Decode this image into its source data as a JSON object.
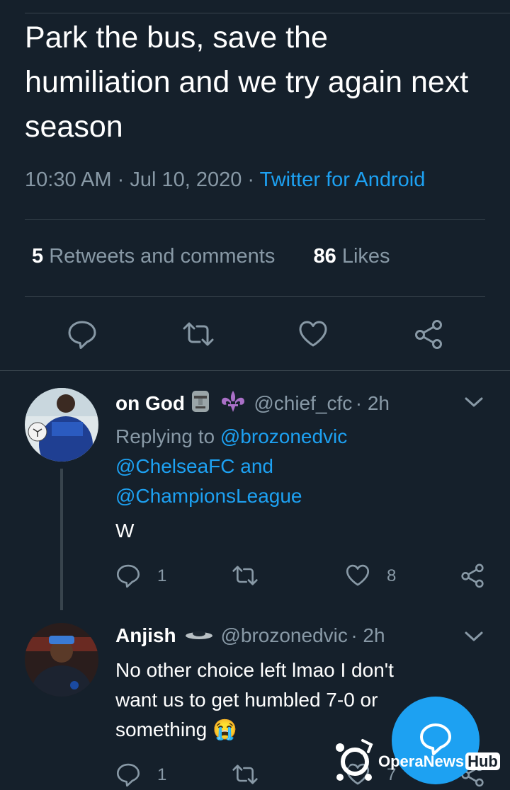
{
  "tweet": {
    "text": "Park the bus, save the humiliation and we try again next season",
    "time": "10:30 AM",
    "date": "Jul 10, 2020",
    "source": "Twitter for Android",
    "sep": "·",
    "retweets_count": "5",
    "retweets_label": "Retweets and comments",
    "likes_count": "86",
    "likes_label": "Likes"
  },
  "actions": {
    "icons": [
      "reply-icon",
      "retweet-icon",
      "like-icon",
      "share-icon"
    ]
  },
  "replies": [
    {
      "name": "on God",
      "handle": "@chief_cfc",
      "time": "· 2h",
      "replying_prefix": "Replying to ",
      "mention1": "@brozonedvic",
      "mention2": "@ChelseaFC",
      "mention_and": " and",
      "mention3": "@ChampionsLeague",
      "text": "W",
      "reply_count": "1",
      "like_count": "8"
    },
    {
      "name": "Anjish",
      "handle": "@brozonedvic",
      "time": "· 2h",
      "text_line1": "No other choice left lmao I don't",
      "text_line2": "want us to get humbled 7-0 or",
      "text_line3": "something",
      "emoji": "😭",
      "reply_count": "1",
      "like_count": "7"
    }
  ],
  "watermark": {
    "brand_a": "OperaNews",
    "brand_b": "Hub"
  },
  "colors": {
    "background": "#15202b",
    "accent": "#1da1f2",
    "muted": "#8899a6",
    "divider": "#38444d"
  }
}
